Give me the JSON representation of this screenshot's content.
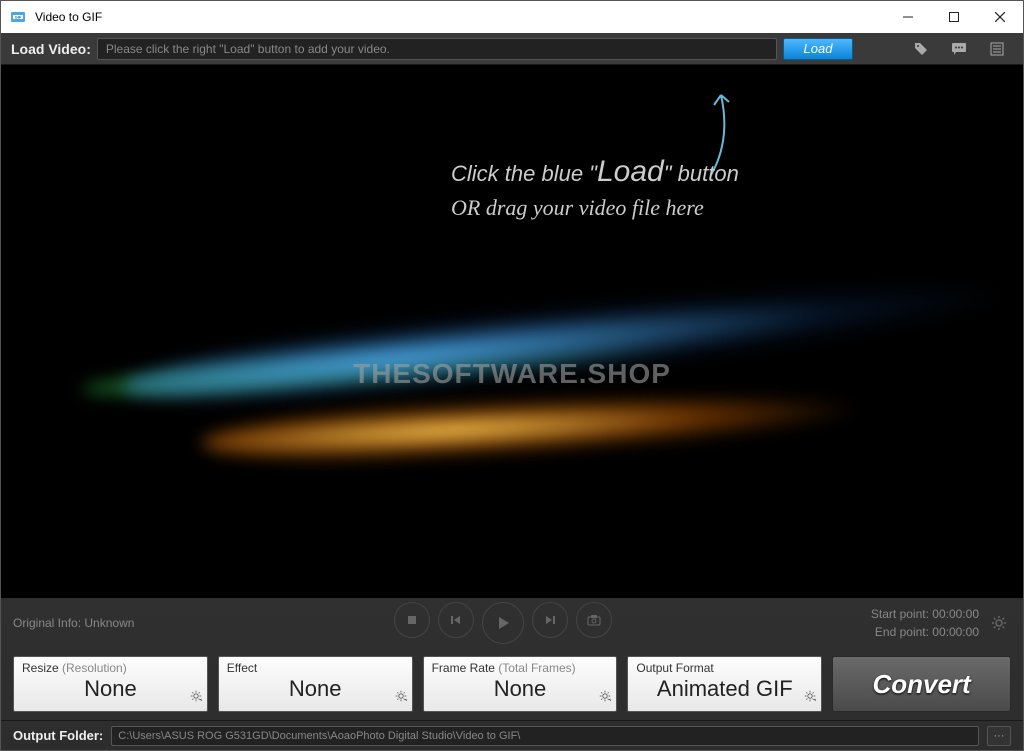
{
  "window": {
    "title": "Video to GIF"
  },
  "loadbar": {
    "label": "Load Video:",
    "placeholder": "Please click the right \"Load\" button to add your video.",
    "load_button": "Load"
  },
  "preview": {
    "instruction_line1_prefix": "Click the blue \"",
    "instruction_line1_emph": "Load",
    "instruction_line1_suffix": "\" button",
    "instruction_line2": "OR drag your video file here",
    "watermark": "THESOFTWARE.SHOP"
  },
  "playbar": {
    "original_info_label": "Original Info: ",
    "original_info_value": "Unknown",
    "start_label": "Start point: ",
    "start_value": "00:00:00",
    "end_label": "End point: ",
    "end_value": "00:00:00"
  },
  "settings": {
    "resize": {
      "label": "Resize ",
      "sublabel": "(Resolution)",
      "value": "None"
    },
    "effect": {
      "label": "Effect",
      "value": "None"
    },
    "framerate": {
      "label": "Frame Rate ",
      "sublabel": "(Total Frames)",
      "value": "None"
    },
    "format": {
      "label": "Output Format",
      "value": "Animated GIF"
    },
    "convert": "Convert"
  },
  "output": {
    "label": "Output Folder:",
    "path": "C:\\Users\\ASUS ROG G531GD\\Documents\\AoaoPhoto Digital Studio\\Video to GIF\\"
  }
}
